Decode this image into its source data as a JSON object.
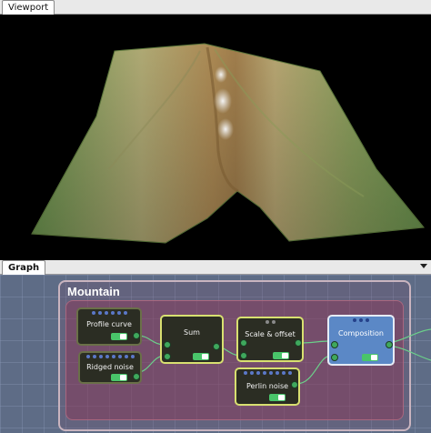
{
  "tabs": {
    "viewport": {
      "label": "Viewport"
    },
    "graph": {
      "label": "Graph"
    }
  },
  "graph": {
    "group_title": "Mountain",
    "nodes": {
      "profile_curve": {
        "label": "Profile curve"
      },
      "ridged_noise": {
        "label": "Ridged noise"
      },
      "sum": {
        "label": "Sum"
      },
      "scale_offset": {
        "label": "Scale & offset"
      },
      "perlin_noise": {
        "label": "Perlin noise"
      },
      "composition": {
        "label": "Composition"
      }
    }
  },
  "colors": {
    "graph_bg": "#5e6c86",
    "group_fill": "#8c3255",
    "wire": "#6bd08a",
    "node_selected": "#d8e070",
    "composition_node": "#5b88c6"
  },
  "icons": {
    "tab_menu": "chevron-down-icon"
  }
}
